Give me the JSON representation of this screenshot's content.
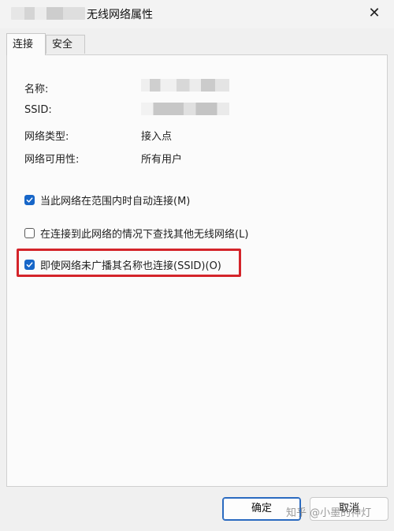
{
  "window": {
    "title": "无线网络属性",
    "close_glyph": "✕"
  },
  "tabs": [
    {
      "label": "连接",
      "active": true
    },
    {
      "label": "安全",
      "active": false
    }
  ],
  "properties": {
    "name_label": "名称:",
    "ssid_label": "SSID:",
    "network_type_label": "网络类型:",
    "network_type_value": "接入点",
    "availability_label": "网络可用性:",
    "availability_value": "所有用户"
  },
  "options": [
    {
      "label": "当此网络在范围内时自动连接(M)",
      "checked": true
    },
    {
      "label": "在连接到此网络的情况下查找其他无线网络(L)",
      "checked": false
    },
    {
      "label": "即使网络未广播其名称也连接(SSID)(O)",
      "checked": true
    }
  ],
  "buttons": {
    "ok": "确定",
    "cancel": "取消"
  },
  "watermark": "知乎 @小墨的神灯",
  "colors": {
    "accent": "#1766c8",
    "highlight": "#d4242a",
    "background": "#f0f0f0"
  }
}
